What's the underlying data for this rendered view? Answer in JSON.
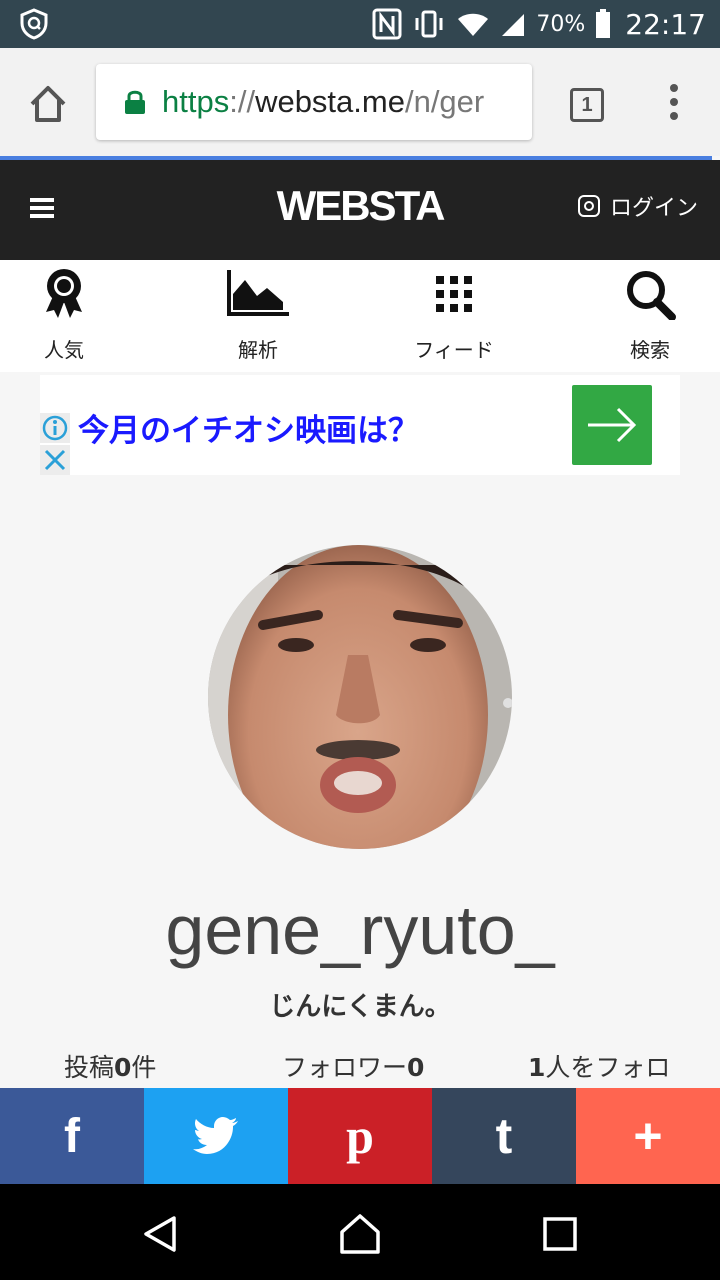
{
  "status_bar": {
    "battery": "70%",
    "time": "22:17"
  },
  "browser": {
    "url_scheme": "https",
    "url_sep": "://",
    "url_host": "websta.me",
    "url_path": "/n/ger",
    "tab_count": "1"
  },
  "site": {
    "logo": "WEBSTA",
    "login_label": "ログイン"
  },
  "nav": [
    {
      "label": "人気",
      "icon": "award-icon"
    },
    {
      "label": "解析",
      "icon": "area-chart-icon"
    },
    {
      "label": "フィード",
      "icon": "grid-icon"
    },
    {
      "label": "検索",
      "icon": "search-icon"
    }
  ],
  "ad": {
    "text": "今月のイチオシ映画は？",
    "button_color": "#32a844"
  },
  "profile": {
    "username": "gene_ryuto_",
    "bio": "じんにくまん。",
    "posts_label": "投稿",
    "posts_count": "0",
    "posts_unit": "件",
    "followers_label": "フォロワー",
    "followers_count": "0",
    "following_count": "1",
    "following_label": "人をフォロ"
  },
  "share": [
    {
      "name": "facebook",
      "glyph": "f",
      "color": "#3b5998"
    },
    {
      "name": "twitter",
      "glyph": "twitter-bird",
      "color": "#1da1f2"
    },
    {
      "name": "pinterest",
      "glyph": "p",
      "color": "#cb2027"
    },
    {
      "name": "tumblr",
      "glyph": "t",
      "color": "#35465c"
    },
    {
      "name": "more",
      "glyph": "+",
      "color": "#ff6550"
    }
  ]
}
